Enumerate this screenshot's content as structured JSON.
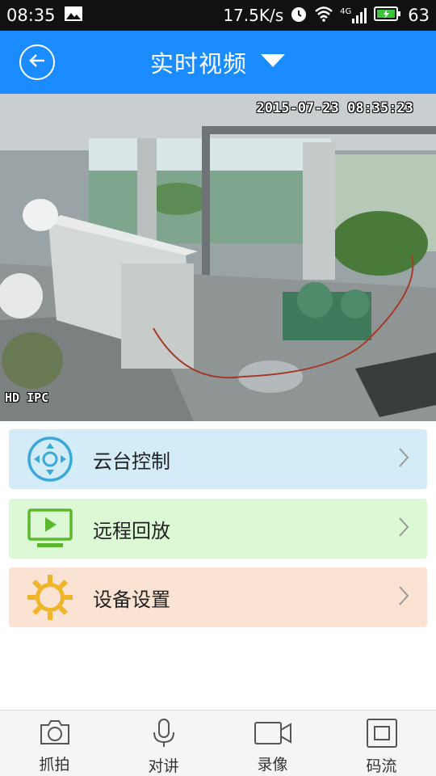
{
  "status_bar": {
    "time": "08:35",
    "speed": "17.5K/s",
    "network": "4G",
    "battery": "63"
  },
  "header": {
    "title": "实时视频"
  },
  "video": {
    "timestamp": "2015-07-23 08:35:23",
    "label": "HD IPC"
  },
  "menu": [
    {
      "label": "云台控制",
      "icon": "ptz-control-icon",
      "color": "#3aa8d8"
    },
    {
      "label": "远程回放",
      "icon": "playback-icon",
      "color": "#5cb82e"
    },
    {
      "label": "设备设置",
      "icon": "gear-icon",
      "color": "#f0b429"
    }
  ],
  "bottom_tabs": [
    {
      "label": "抓拍",
      "icon": "camera-icon"
    },
    {
      "label": "对讲",
      "icon": "microphone-icon"
    },
    {
      "label": "录像",
      "icon": "video-record-icon"
    },
    {
      "label": "码流",
      "icon": "stream-icon"
    }
  ],
  "colors": {
    "header": "#1a8cff",
    "status_bar": "#111111"
  }
}
